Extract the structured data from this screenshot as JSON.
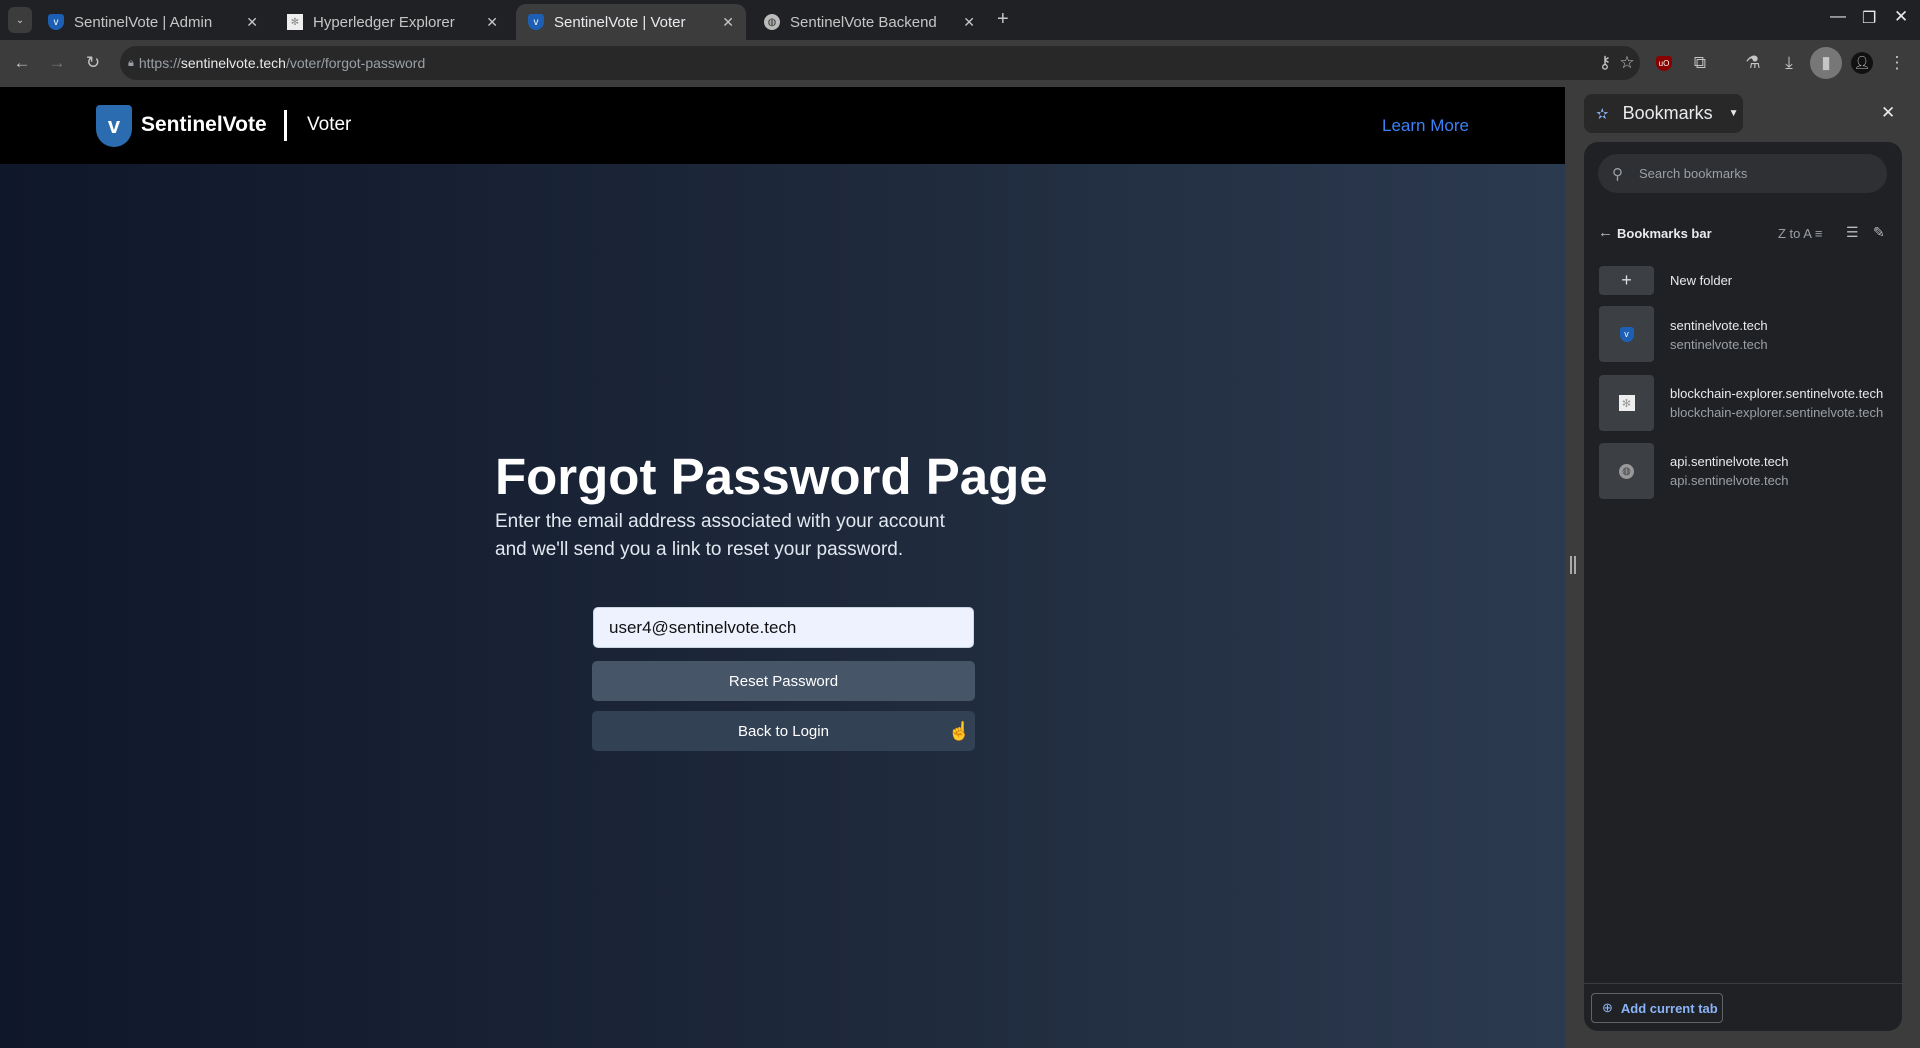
{
  "browser": {
    "tabs": [
      {
        "title": "SentinelVote | Admin",
        "icon": "shield-v-icon",
        "active": false
      },
      {
        "title": "Hyperledger Explorer",
        "icon": "hyperledger-icon",
        "active": false
      },
      {
        "title": "SentinelVote | Voter",
        "icon": "shield-v-icon",
        "active": true
      },
      {
        "title": "SentinelVote Backend",
        "icon": "globe-icon",
        "active": false
      }
    ],
    "url_scheme": "https://",
    "url_host": "sentinelvote.tech",
    "url_path": "/voter/forgot-password"
  },
  "app": {
    "brand": "SentinelVote",
    "section": "Voter",
    "learn_more": "Learn More",
    "accent": "#3b82f6",
    "title": "Forgot Password Page",
    "subtitle_line1": "Enter the email address associated with your account",
    "subtitle_line2": "and we'll send you a link to reset your password.",
    "email_value": "user4@sentinelvote.tech",
    "reset_label": "Reset Password",
    "back_label": "Back to Login"
  },
  "bookmarks": {
    "header": "Bookmarks",
    "search_placeholder": "Search bookmarks",
    "folder": "Bookmarks bar",
    "sort": "Z to A",
    "new_folder": "New folder",
    "items": [
      {
        "title": "sentinelvote.tech",
        "url": "sentinelvote.tech",
        "icon": "shield-v-icon"
      },
      {
        "title": "blockchain-explorer.sentinelvote.tech",
        "url": "blockchain-explorer.sentinelvote.tech",
        "icon": "hyperledger-icon"
      },
      {
        "title": "api.sentinelvote.tech",
        "url": "api.sentinelvote.tech",
        "icon": "globe-icon"
      }
    ],
    "add_current_tab": "Add current tab"
  }
}
